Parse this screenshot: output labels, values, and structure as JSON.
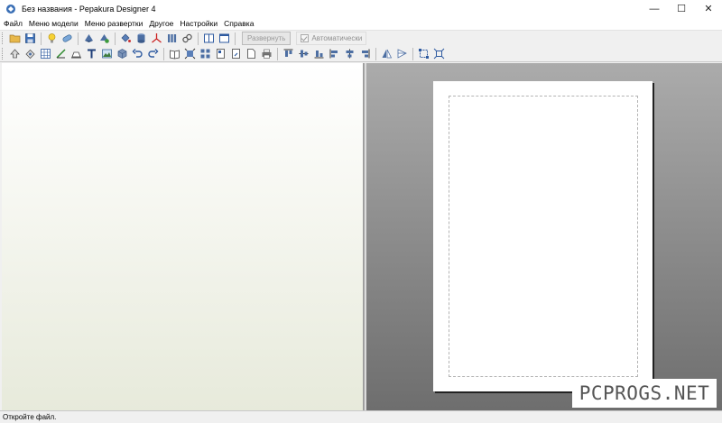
{
  "window": {
    "title": "Без названия - Pepakura Designer 4",
    "minimize_glyph": "—",
    "maximize_glyph": "☐",
    "close_glyph": "✕"
  },
  "menu": {
    "items": [
      "Файл",
      "Меню модели",
      "Меню развертки",
      "Другое",
      "Настройки",
      "Справка"
    ]
  },
  "toolbar1": {
    "icons": [
      "open-icon",
      "save-icon",
      "light-bulb-icon",
      "capsule-icon",
      "rotate-model-icon",
      "rotate-model-alt-icon",
      "paint-bucket-icon",
      "cylinder-icon",
      "axis-icon",
      "columns-icon",
      "link-icon",
      "split-view-icon",
      "single-view-icon"
    ],
    "unfold_label": "Развернуть",
    "auto_label": "Автоматически"
  },
  "toolbar2": {
    "icons": [
      "select-icon",
      "rotate-icon",
      "grid-icon",
      "edge-icon",
      "flap-icon",
      "text-icon",
      "image-icon",
      "cube-icon",
      "undo-icon",
      "redo-icon",
      "book-icon",
      "fit-icon",
      "arrange-icon",
      "page-icon",
      "page-move-icon",
      "document-icon",
      "print-icon",
      "align-top-icon",
      "align-middle-icon",
      "align-bottom-icon",
      "align-left-icon",
      "align-center-icon",
      "align-right-icon",
      "mirror-icon",
      "reflect-icon",
      "frame-select-icon",
      "frame-expand-icon"
    ]
  },
  "watermark": "PCPROGS.NET",
  "status": {
    "text": "Откройте файл."
  }
}
